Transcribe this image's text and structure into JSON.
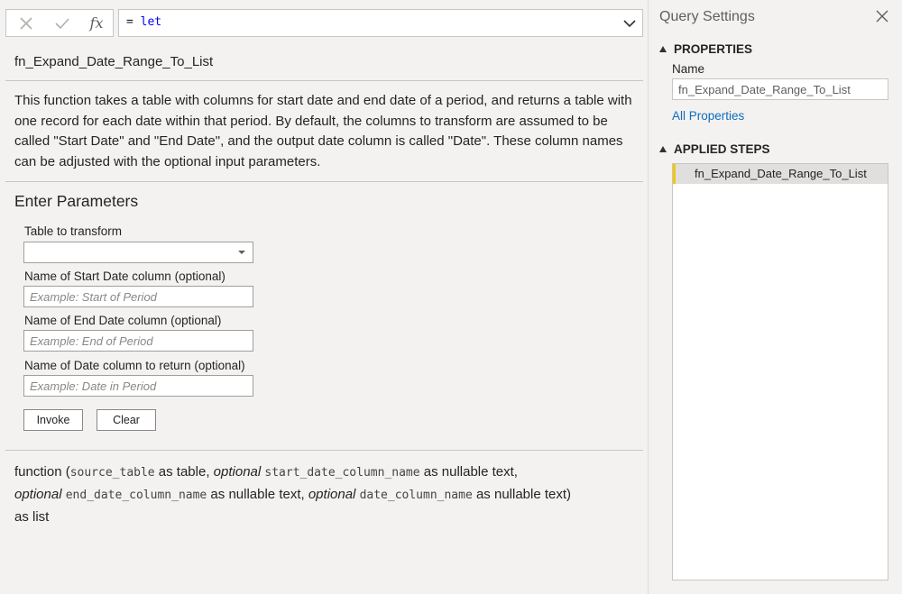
{
  "formula_bar": {
    "cancel_icon": "x-icon",
    "commit_icon": "check-icon",
    "fx_label": "fx",
    "formula_prefix": "=",
    "formula_keyword": "let"
  },
  "function": {
    "name": "fn_Expand_Date_Range_To_List",
    "description": "This function takes a table with columns for start date and end date of a period, and returns a table with one record for each date within that period. By default, the columns to transform are assumed to be called \"Start Date\" and \"End Date\", and the output date column is called \"Date\". These column names can be adjusted with the optional input parameters."
  },
  "parameters": {
    "title": "Enter Parameters",
    "table_label": "Table to transform",
    "table_value": "",
    "start_label": "Name of Start Date column (optional)",
    "start_placeholder": "Example: Start of Period",
    "end_label": "Name of End Date column (optional)",
    "end_placeholder": "Example: End of Period",
    "date_label": "Name of Date column to return (optional)",
    "date_placeholder": "Example: Date in Period",
    "invoke_label": "Invoke",
    "clear_label": "Clear"
  },
  "signature": {
    "w1": "function (",
    "c1": "source_table",
    "w2": " as table, ",
    "o1": "optional",
    "c2": "start_date_column_name",
    "w3": " as nullable text,",
    "o2": "optional",
    "c3": "end_date_column_name",
    "w4": " as nullable text, ",
    "o3": "optional",
    "c4": "date_column_name",
    "w5": " as nullable text)",
    "w6": "as list"
  },
  "query_settings": {
    "title": "Query Settings",
    "properties_head": "PROPERTIES",
    "name_label": "Name",
    "name_value": "fn_Expand_Date_Range_To_List",
    "all_properties_link": "All Properties",
    "applied_steps_head": "APPLIED STEPS",
    "steps": [
      {
        "label": "fn_Expand_Date_Range_To_List"
      }
    ]
  },
  "colors": {
    "background": "#f3f2f1",
    "link": "#0f6cbd",
    "step_accent": "#f2c811",
    "step_selected": "#e1dfdd"
  }
}
